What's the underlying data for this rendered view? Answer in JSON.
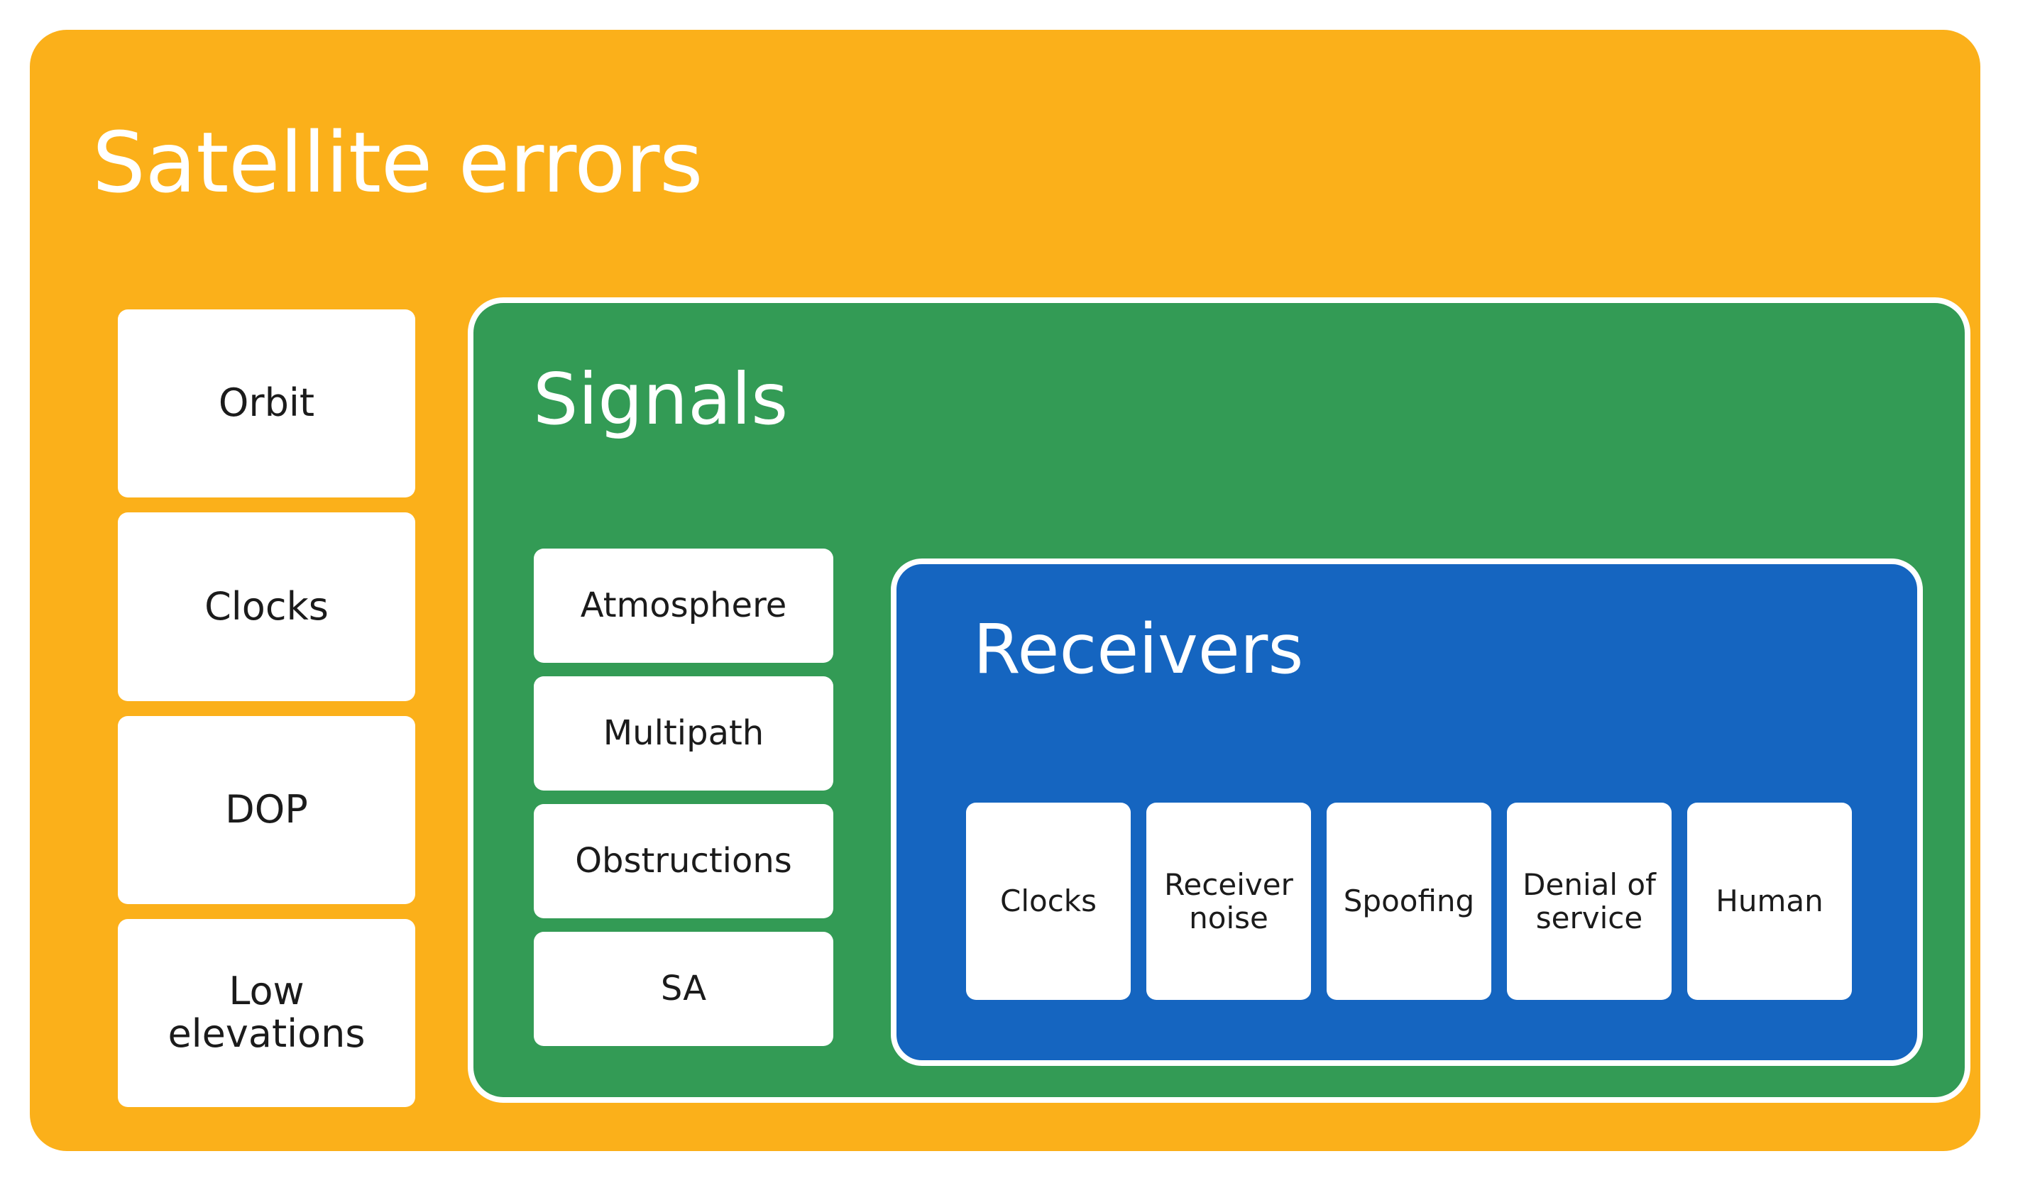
{
  "diagram": {
    "title": "Satellite errors",
    "colors": {
      "satellite": "#fbb01a",
      "signals": "#339b55",
      "receivers": "#1565c0",
      "leaf_background": "#ffffff",
      "leaf_text": "#1b1b1b",
      "title_text": "#ffffff",
      "page_background": "#ffffff"
    }
  },
  "satellite": {
    "title": "Satellite errors",
    "items": [
      {
        "label": "Orbit"
      },
      {
        "label": "Clocks"
      },
      {
        "label": "DOP"
      },
      {
        "label": "Low elevations"
      }
    ]
  },
  "signals": {
    "title": "Signals",
    "items": [
      {
        "label": "Atmosphere"
      },
      {
        "label": "Multipath"
      },
      {
        "label": "Obstructions"
      },
      {
        "label": "SA"
      }
    ]
  },
  "receivers": {
    "title": "Receivers",
    "items": [
      {
        "label": "Clocks"
      },
      {
        "label": "Receiver noise"
      },
      {
        "label": "Spoofing"
      },
      {
        "label": "Denial of service"
      },
      {
        "label": "Human"
      }
    ]
  }
}
